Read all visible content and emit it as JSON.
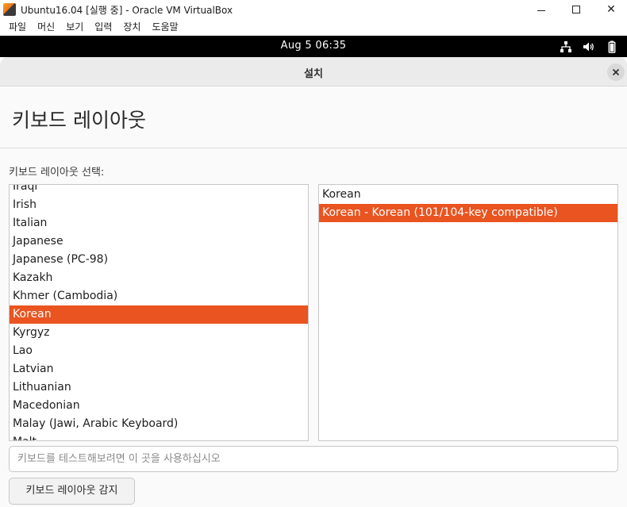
{
  "host_window": {
    "title": "Ubuntu16.04 [실행 중] - Oracle VM VirtualBox",
    "app_icon": "virtualbox-icon",
    "controls": {
      "minimize": "minimize-icon",
      "maximize": "maximize-icon",
      "close": "✕"
    }
  },
  "host_menu": {
    "items": [
      {
        "label": "파일"
      },
      {
        "label": "머신"
      },
      {
        "label": "보기"
      },
      {
        "label": "입력"
      },
      {
        "label": "장치"
      },
      {
        "label": "도움말"
      }
    ]
  },
  "guest_panel": {
    "clock": "Aug 5  06:35",
    "icons": [
      "network-icon",
      "volume-icon",
      "battery-icon"
    ]
  },
  "installer": {
    "window_title": "설치",
    "close_icon": "✕",
    "page_title": "키보드 레이아웃",
    "section_label": "키보드 레이아웃 선택:",
    "layouts": [
      {
        "label": "Iraqi"
      },
      {
        "label": "Irish"
      },
      {
        "label": "Italian"
      },
      {
        "label": "Japanese"
      },
      {
        "label": "Japanese (PC-98)"
      },
      {
        "label": "Kazakh"
      },
      {
        "label": "Khmer (Cambodia)"
      },
      {
        "label": "Korean",
        "selected": true
      },
      {
        "label": "Kyrgyz"
      },
      {
        "label": "Lao"
      },
      {
        "label": "Latvian"
      },
      {
        "label": "Lithuanian"
      },
      {
        "label": "Macedonian"
      },
      {
        "label": "Malay (Jawi, Arabic Keyboard)"
      },
      {
        "label": "Malt"
      }
    ],
    "variants": [
      {
        "label": "Korean"
      },
      {
        "label": "Korean - Korean (101/104-key compatible)",
        "selected": true
      }
    ],
    "test_input": {
      "placeholder": "키보드를 테스트해보려면 이 곳을 사용하십시오",
      "value": ""
    },
    "detect_button": "키보드 레이아웃 감지",
    "accent_color": "#e95420"
  }
}
